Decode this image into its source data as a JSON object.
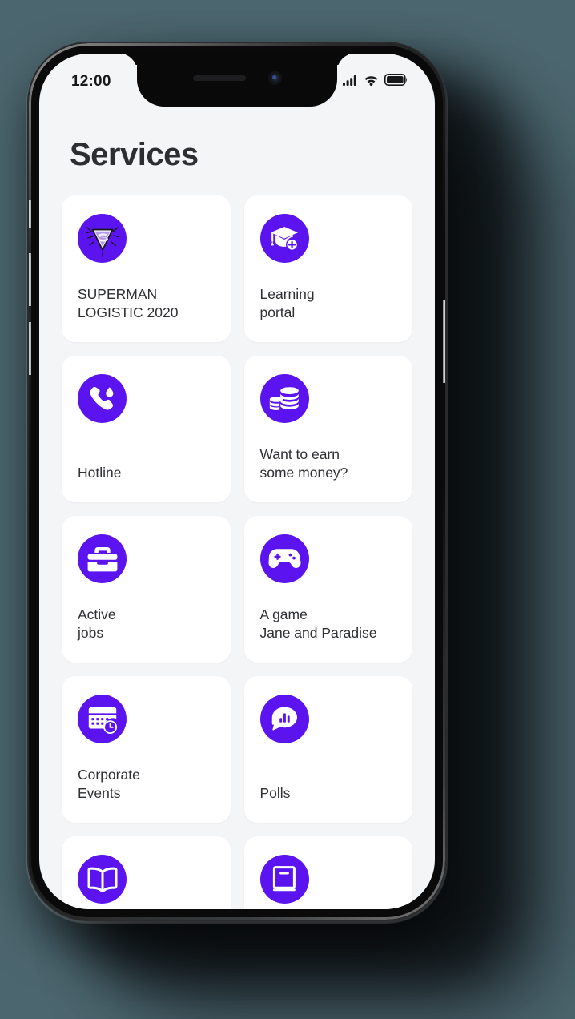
{
  "status_bar": {
    "time": "12:00",
    "icons": [
      "cellular-signal-icon",
      "wifi-icon",
      "battery-icon"
    ],
    "signal_bars": 4,
    "battery_level": "full"
  },
  "header": {
    "title": "Services"
  },
  "theme": {
    "accent": "#5b14f0",
    "page_background": "#4c666f",
    "screen_background": "#f4f5f7",
    "card_background": "#ffffff",
    "title_color": "#2d2e32",
    "label_color": "#2e3034"
  },
  "services": [
    {
      "label": "SUPERMAN\nLOGISTIC 2020",
      "icon": "superman-shield-icon"
    },
    {
      "label": "Learning\nportal",
      "icon": "graduation-cap-plus-icon"
    },
    {
      "label": "Hotline",
      "icon": "phone-droplet-icon"
    },
    {
      "label": "Want to earn\nsome money?",
      "icon": "coins-stack-icon"
    },
    {
      "label": "Active\njobs",
      "icon": "toolbox-icon"
    },
    {
      "label": "A game\nJane and Paradise",
      "icon": "gamepad-icon"
    },
    {
      "label": "Corporate\nEvents",
      "icon": "calendar-clock-icon"
    },
    {
      "label": "Polls",
      "icon": "chat-bar-chart-icon"
    },
    {
      "label": "",
      "icon": "open-book-icon"
    },
    {
      "label": "",
      "icon": "closed-book-icon"
    }
  ]
}
